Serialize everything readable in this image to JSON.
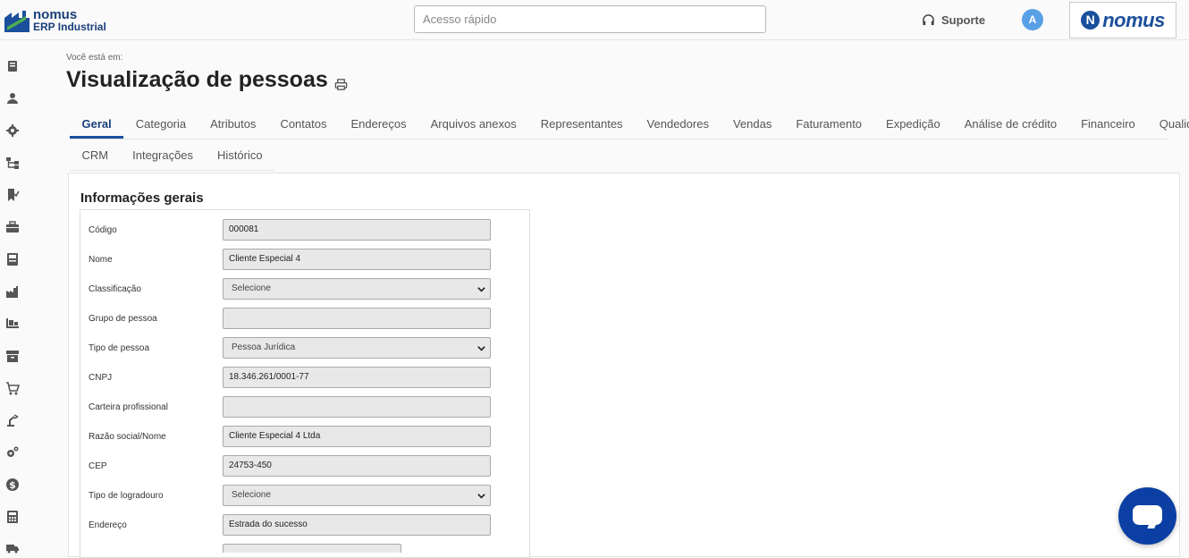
{
  "app": {
    "logo_name": "nomus",
    "logo_sub": "ERP Industrial",
    "brand_logo_text": "nomus",
    "brand_logo_letter": "N"
  },
  "header": {
    "quick_access_placeholder": "Acesso rápido",
    "support_label": "Suporte",
    "avatar_initial": "A"
  },
  "sidebar": {
    "icons": [
      "book-icon",
      "person-icon",
      "gear-icon",
      "hierarchy-icon",
      "bookmark-check-icon",
      "briefcase-icon",
      "document-icon",
      "factory-icon",
      "pallet-icon",
      "archive-box-icon",
      "shopping-cart-icon",
      "robot-arm-icon",
      "gears-icon",
      "dollar-icon",
      "calculator-icon",
      "truck-icon"
    ]
  },
  "page": {
    "breadcrumb_label": "Você está em:",
    "title": "Visualização de pessoas"
  },
  "tabs": {
    "row1": [
      "Geral",
      "Categoria",
      "Atributos",
      "Contatos",
      "Endereços",
      "Arquivos anexos",
      "Representantes",
      "Vendedores",
      "Vendas",
      "Faturamento",
      "Expedição",
      "Análise de crédito",
      "Financeiro",
      "Qualidade"
    ],
    "row2": [
      "CRM",
      "Integrações",
      "Histórico"
    ],
    "active": "Geral"
  },
  "section": {
    "title": "Informações gerais"
  },
  "form": {
    "fields": [
      {
        "label": "Código",
        "value": "000081",
        "type": "text"
      },
      {
        "label": "Nome",
        "value": "Cliente Especial 4",
        "type": "text"
      },
      {
        "label": "Classificação",
        "value": "Selecione",
        "type": "select"
      },
      {
        "label": "Grupo de pessoa",
        "value": "",
        "type": "text"
      },
      {
        "label": "Tipo de pessoa",
        "value": "Pessoa Jurídica",
        "type": "select"
      },
      {
        "label": "CNPJ",
        "value": "18.346.261/0001-77",
        "type": "text"
      },
      {
        "label": "Carteira profissional",
        "value": "",
        "type": "text"
      },
      {
        "label": "Razão social/Nome",
        "value": "Cliente Especial 4 Ltda",
        "type": "text"
      },
      {
        "label": "CEP",
        "value": "24753-450",
        "type": "text"
      },
      {
        "label": "Tipo de logradouro",
        "value": "Selecione",
        "type": "select"
      },
      {
        "label": "Endereço",
        "value": "Estrada do sucesso",
        "type": "text"
      }
    ]
  }
}
